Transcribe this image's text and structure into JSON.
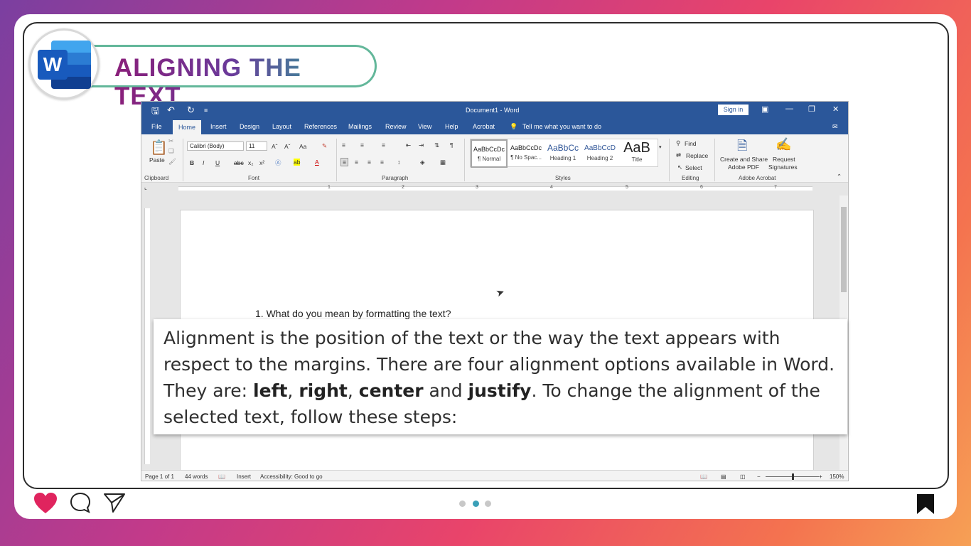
{
  "header": {
    "title": "ALIGNING THE TEXT",
    "logo_letter": "W"
  },
  "window": {
    "doc_title": "Document1  -  Word",
    "sign_in": "Sign in",
    "tabs": [
      "File",
      "Home",
      "Insert",
      "Design",
      "Layout",
      "References",
      "Mailings",
      "Review",
      "View",
      "Help",
      "Acrobat"
    ],
    "active_tab": "Home",
    "tell_me": "Tell me what you want to do"
  },
  "ribbon": {
    "clipboard": {
      "paste": "Paste",
      "label": "Clipboard"
    },
    "font": {
      "name": "Calibri (Body)",
      "size": "11",
      "label": "Font",
      "case": "Aa",
      "bold": "B",
      "italic": "I",
      "underline": "U",
      "strike": "abc",
      "sub": "x₂",
      "sup": "x²"
    },
    "paragraph": {
      "label": "Paragraph"
    },
    "styles": {
      "label": "Styles",
      "items": [
        {
          "sample": "AaBbCcDc",
          "name": "¶ Normal"
        },
        {
          "sample": "AaBbCcDc",
          "name": "¶ No Spac..."
        },
        {
          "sample": "AaBbCc",
          "name": "Heading 1"
        },
        {
          "sample": "AaBbCcD",
          "name": "Heading 2"
        },
        {
          "sample": "AaB",
          "name": "Title"
        }
      ]
    },
    "editing": {
      "find": "Find",
      "replace": "Replace",
      "select": "Select",
      "label": "Editing"
    },
    "acrobat": {
      "create": "Create and Share",
      "create2": "Adobe PDF",
      "request": "Request",
      "request2": "Signatures",
      "label": "Adobe Acrobat"
    }
  },
  "ruler_numbers": [
    "1",
    "2",
    "3",
    "4",
    "5",
    "6",
    "7"
  ],
  "document": {
    "question": "1. What do you mean by formatting the text?"
  },
  "status": {
    "page": "Page 1 of 1",
    "words": "44 words",
    "mode": "Insert",
    "accessibility": "Accessibility: Good to go",
    "zoom": "150%"
  },
  "caption": {
    "text_before": "Alignment is the position of the text or the way the text appears with respect to the margins. There are four alignment options available in Word. They are: ",
    "left": "left",
    "sep1": ", ",
    "right": "right",
    "sep2": ", ",
    "center": "center",
    "and": " and ",
    "justify": "justify",
    "text_after": ". To change the alignment of the selected text, follow these steps:"
  },
  "colors": {
    "word_blue": "#2b579a",
    "heart": "#e0245e",
    "dot_active": "#3aa0b8"
  },
  "pagination": {
    "total": 3,
    "active": 2
  }
}
